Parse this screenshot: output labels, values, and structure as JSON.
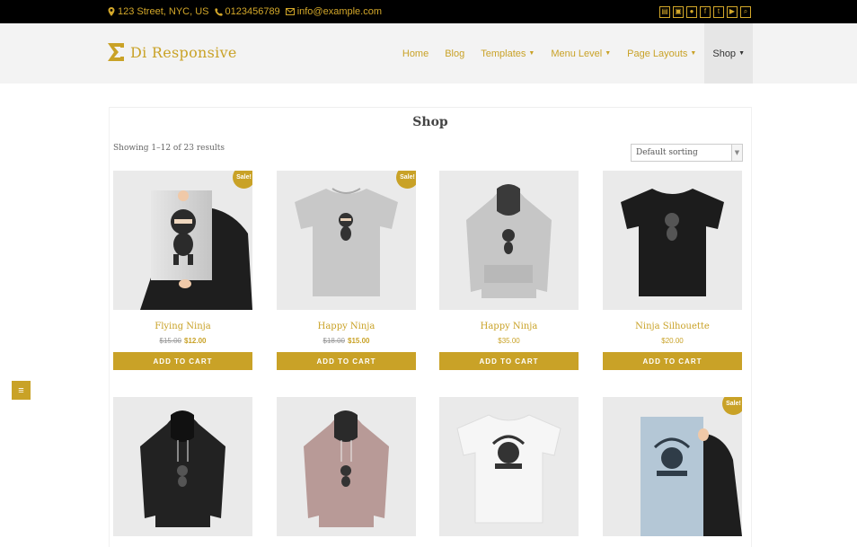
{
  "topbar": {
    "address": "123 Street, NYC, US",
    "phone": "0123456789",
    "email": "info@example.com",
    "social_icons": [
      "shop-icon",
      "cart-icon",
      "user-icon",
      "facebook-icon",
      "twitter-icon",
      "youtube-icon",
      "search-icon"
    ]
  },
  "header": {
    "logo_text": "Di Responsive",
    "nav": [
      {
        "label": "Home",
        "has_caret": false
      },
      {
        "label": "Blog",
        "has_caret": false
      },
      {
        "label": "Templates",
        "has_caret": true
      },
      {
        "label": "Menu Level",
        "has_caret": true
      },
      {
        "label": "Page Layouts",
        "has_caret": true
      },
      {
        "label": "Shop",
        "has_caret": true,
        "active": true
      }
    ]
  },
  "shop": {
    "title": "Shop",
    "result_count": "Showing 1–12 of 23 results",
    "sort_selected": "Default sorting",
    "add_to_cart_label": "ADD TO CART",
    "sale_label": "Sale!"
  },
  "products": [
    {
      "name": "Flying Ninja",
      "old_price": "$15.00",
      "price": "$12.00",
      "sale": true,
      "image": "poster-ninja"
    },
    {
      "name": "Happy Ninja",
      "old_price": "$18.00",
      "price": "$15.00",
      "sale": true,
      "image": "tshirt-grey-ninja"
    },
    {
      "name": "Happy Ninja",
      "old_price": "",
      "price": "$35.00",
      "sale": false,
      "image": "hoodie-grey-ninja"
    },
    {
      "name": "Ninja Silhouette",
      "old_price": "",
      "price": "$20.00",
      "sale": false,
      "image": "tshirt-black-ninja"
    },
    {
      "name": "",
      "old_price": "",
      "price": "",
      "sale": false,
      "image": "hoodie-black-ninja"
    },
    {
      "name": "",
      "old_price": "",
      "price": "",
      "sale": false,
      "image": "hoodie-pink-ninja"
    },
    {
      "name": "",
      "old_price": "",
      "price": "",
      "sale": false,
      "image": "tshirt-white-woothemes"
    },
    {
      "name": "",
      "old_price": "",
      "price": "",
      "sale": true,
      "image": "poster-woothemes"
    }
  ],
  "colors": {
    "accent": "#c9a227",
    "topbar_bg": "#000000",
    "header_bg": "#f3f3f3",
    "thumb_bg": "#eaeaea"
  }
}
